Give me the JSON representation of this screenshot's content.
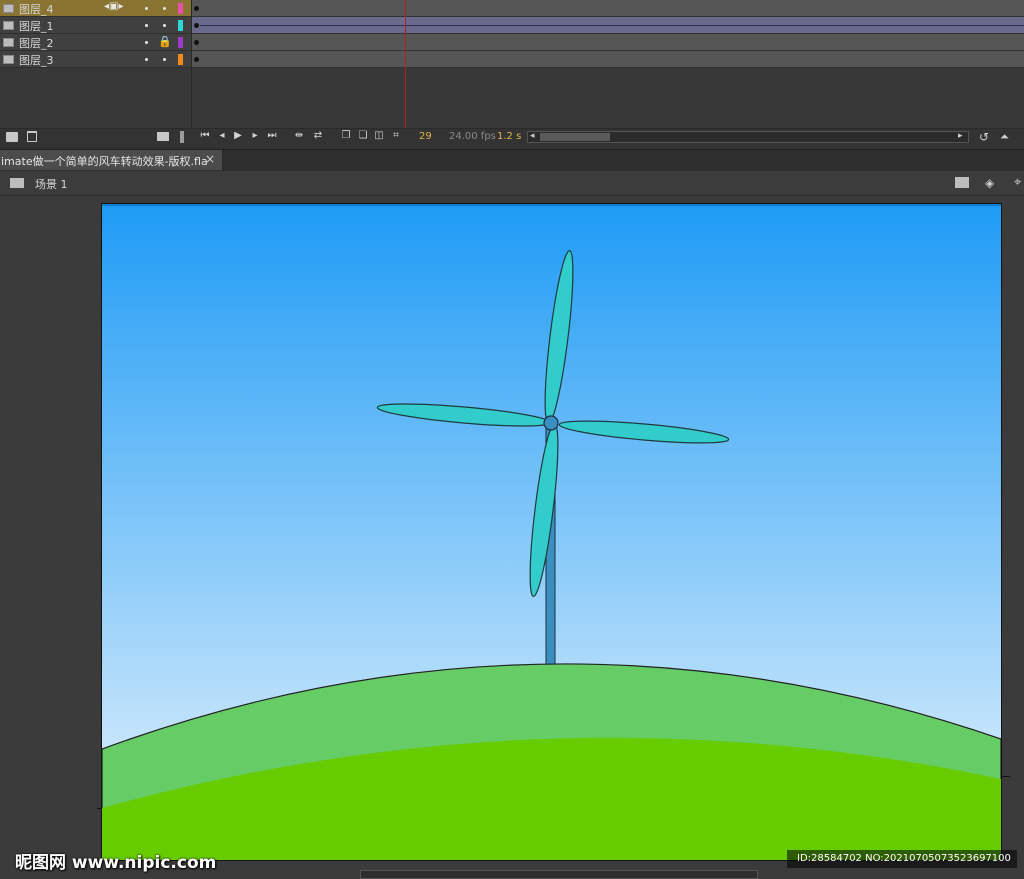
{
  "timeline": {
    "layers": [
      {
        "name": "图层_4",
        "selected": true,
        "color": "#e84fa8",
        "locked": false
      },
      {
        "name": "图层_1",
        "selected": false,
        "color": "#2fd6d6",
        "locked": false
      },
      {
        "name": "图层_2",
        "selected": false,
        "color": "#9a3cc7",
        "locked": true
      },
      {
        "name": "图层_3",
        "selected": false,
        "color": "#f08a1a",
        "locked": false
      }
    ],
    "current_frame": "29",
    "fps": "24.00 fps",
    "elapsed": "1.2 s"
  },
  "document": {
    "tab_title": "imate做一个简单的风车转动效果-版权.fla",
    "close_glyph": "×",
    "scene_label": "场景 1"
  },
  "colors": {
    "sky_top": "#1e9bf5",
    "sky_bottom": "#e8f4fd",
    "hill_light": "#66cc66",
    "hill_dark": "#66cc00",
    "blade": "#33cccc",
    "pole": "#3a8fc0",
    "layer_selected": "#8a7431"
  },
  "watermark": {
    "logo": "昵图网 www.nipic.com",
    "id": "ID:28584702 NO:20210705073523697100"
  }
}
